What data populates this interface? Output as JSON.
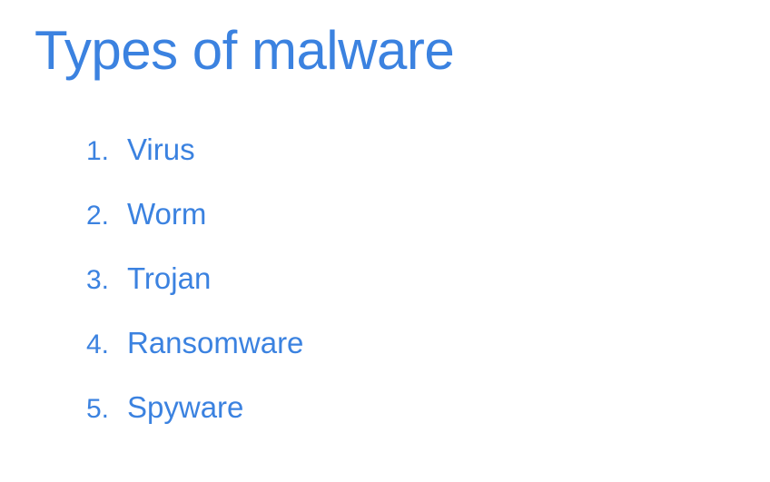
{
  "slide": {
    "title": "Types of malware",
    "list": [
      {
        "number": "1.",
        "label": "Virus"
      },
      {
        "number": "2.",
        "label": "Worm"
      },
      {
        "number": "3.",
        "label": "Trojan"
      },
      {
        "number": "4.",
        "label": "Ransomware"
      },
      {
        "number": "5.",
        "label": "Spyware"
      }
    ]
  },
  "colors": {
    "text": "#3b82e0",
    "background": "#ffffff"
  }
}
